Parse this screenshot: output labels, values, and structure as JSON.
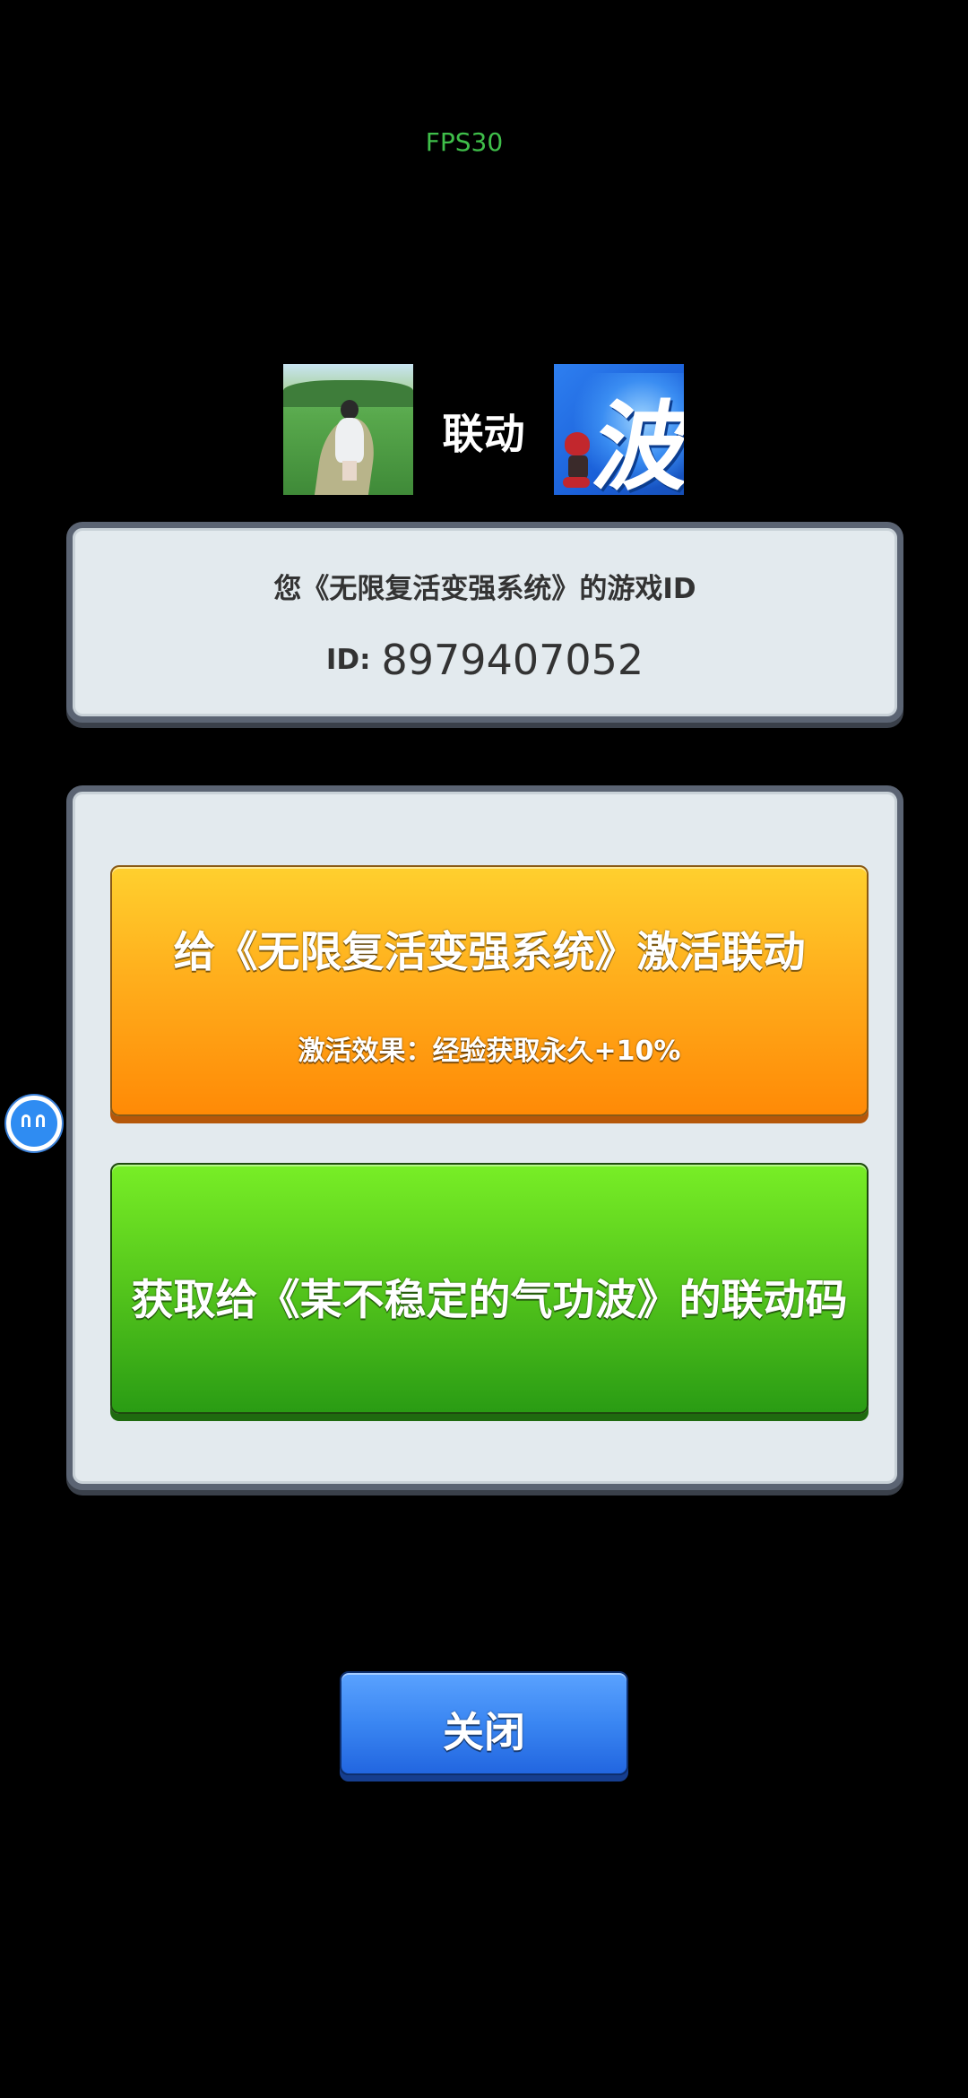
{
  "status": {
    "fps": "FPS30"
  },
  "header": {
    "link_label": "联动",
    "left_game_icon": "game-icon-girl-field",
    "right_game_icon": "game-icon-wave-character"
  },
  "id_panel": {
    "title": "您《无限复活变强系统》的游戏ID",
    "id_prefix": "ID:",
    "id_value": "8979407052"
  },
  "actions": {
    "activate_label": "给《无限复活变强系统》激活联动",
    "activate_effect": "激活效果：经验获取永久+10%",
    "get_code_label": "获取给《某不稳定的气功波》的联动码"
  },
  "footer": {
    "close_label": "关闭"
  },
  "overlay": {
    "floating_ball_icon": "assistant-ball-icon"
  },
  "colors": {
    "background": "#000000",
    "panel": "#e3eaee",
    "panel_border": "#5b6473",
    "activate_button": "#ffae1c",
    "code_button": "#54c51c",
    "close_button": "#3a86f2",
    "fps_text": "#3fbf4a"
  }
}
